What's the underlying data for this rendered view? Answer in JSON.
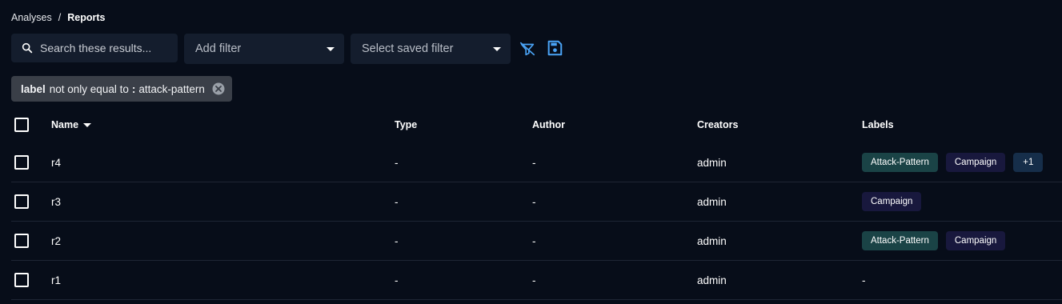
{
  "breadcrumb": {
    "parent": "Analyses",
    "separator": "/",
    "current": "Reports"
  },
  "toolbar": {
    "search_placeholder": "Search these results...",
    "add_filter": "Add filter",
    "saved_filter": "Select saved filter",
    "icons": [
      "search-icon",
      "filter-clear-icon",
      "save-icon"
    ]
  },
  "active_filter": {
    "key": "label",
    "operator": "not only equal to",
    "colon": ":",
    "value": "attack-pattern"
  },
  "table": {
    "columns": {
      "name": "Name",
      "type": "Type",
      "author": "Author",
      "creators": "Creators",
      "labels": "Labels"
    },
    "rows": [
      {
        "name": "r4",
        "type": "-",
        "author": "-",
        "creators": "admin",
        "labels": [
          "Attack-Pattern",
          "Campaign"
        ],
        "more": "+1",
        "labels_empty": ""
      },
      {
        "name": "r3",
        "type": "-",
        "author": "-",
        "creators": "admin",
        "labels": [
          "Campaign"
        ],
        "more": "",
        "labels_empty": ""
      },
      {
        "name": "r2",
        "type": "-",
        "author": "-",
        "creators": "admin",
        "labels": [
          "Attack-Pattern",
          "Campaign"
        ],
        "more": "",
        "labels_empty": ""
      },
      {
        "name": "r1",
        "type": "-",
        "author": "-",
        "creators": "admin",
        "labels": [],
        "more": "",
        "labels_empty": "-"
      }
    ]
  },
  "colors": {
    "background": "#070d19",
    "input_bg": "#141d2d",
    "accent_blue": "#4aa3f5",
    "tag_attack": "#1a4346",
    "tag_campaign": "#18183d",
    "tag_more": "#162e4a"
  }
}
